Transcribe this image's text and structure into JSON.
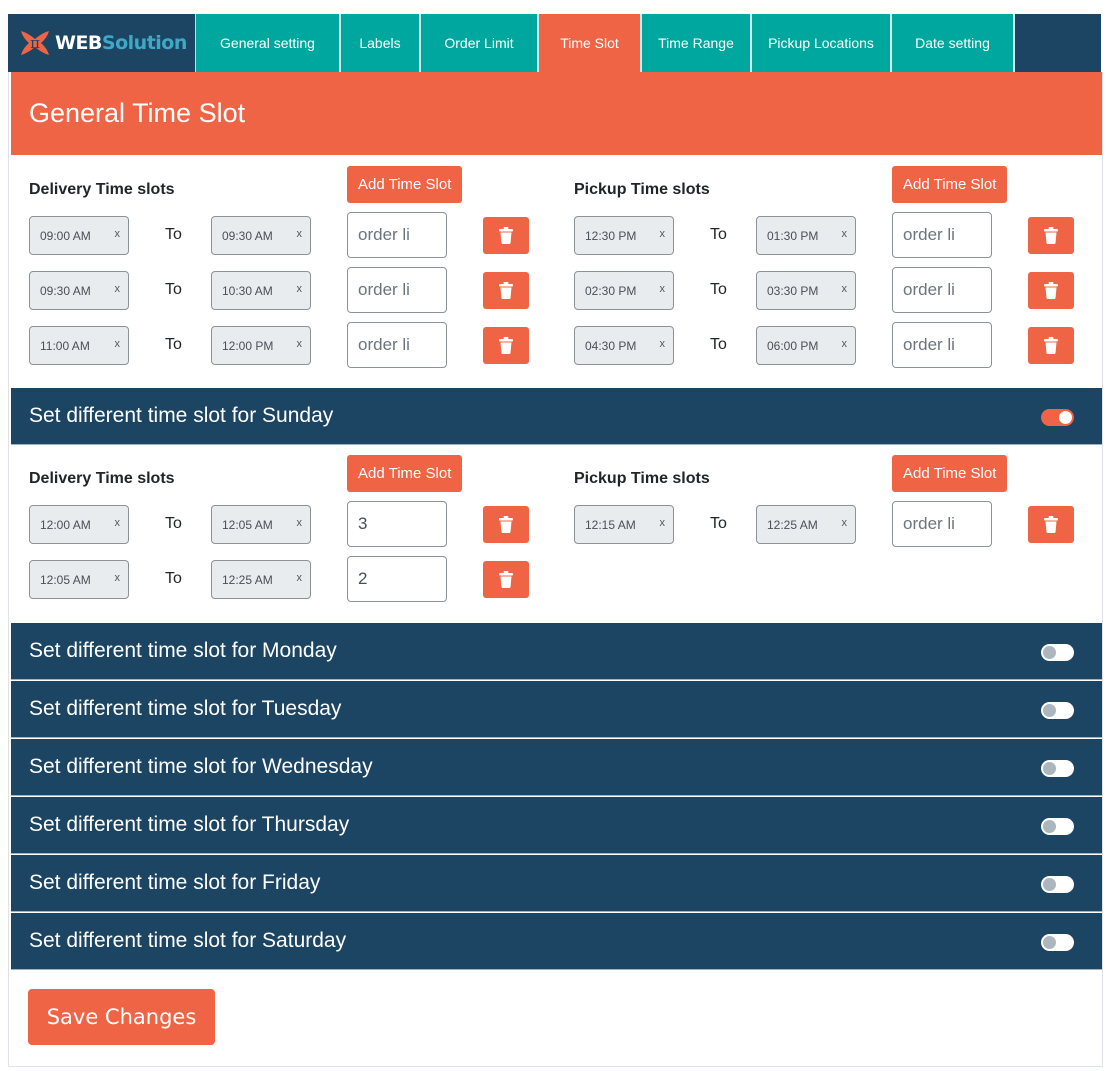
{
  "nav": {
    "logo": {
      "mark": "π",
      "web": "WEB",
      "solution": "Solution"
    },
    "tabs": [
      {
        "label": "General setting",
        "active": false
      },
      {
        "label": "Labels",
        "active": false
      },
      {
        "label": "Order Limit",
        "active": false
      },
      {
        "label": "Time Slot",
        "active": true
      },
      {
        "label": "Time Range",
        "active": false
      },
      {
        "label": "Pickup Locations",
        "active": false
      },
      {
        "label": "Date setting",
        "active": false
      }
    ]
  },
  "section_title": "General Time Slot",
  "general": {
    "delivery": {
      "title": "Delivery Time slots",
      "add_label": "Add Time Slot",
      "rows": [
        {
          "from": "09:00 AM",
          "to": "09:30 AM",
          "limit": "",
          "placeholder": "order li"
        },
        {
          "from": "09:30 AM",
          "to": "10:30 AM",
          "limit": "",
          "placeholder": "order li"
        },
        {
          "from": "11:00 AM",
          "to": "12:00 PM",
          "limit": "",
          "placeholder": "order li"
        }
      ]
    },
    "pickup": {
      "title": "Pickup Time slots",
      "add_label": "Add Time Slot",
      "rows": [
        {
          "from": "12:30 PM",
          "to": "01:30 PM",
          "limit": "",
          "placeholder": "order li"
        },
        {
          "from": "02:30 PM",
          "to": "03:30 PM",
          "limit": "",
          "placeholder": "order li"
        },
        {
          "from": "04:30 PM",
          "to": "06:00 PM",
          "limit": "",
          "placeholder": "order li"
        }
      ]
    }
  },
  "to_label": "To",
  "clear_label": "x",
  "days": [
    {
      "label": "Set different time slot for Sunday",
      "enabled": true
    },
    {
      "label": "Set different time slot for Monday",
      "enabled": false
    },
    {
      "label": "Set different time slot for Tuesday",
      "enabled": false
    },
    {
      "label": "Set different time slot for Wednesday",
      "enabled": false
    },
    {
      "label": "Set different time slot for Thursday",
      "enabled": false
    },
    {
      "label": "Set different time slot for Friday",
      "enabled": false
    },
    {
      "label": "Set different time slot for Saturday",
      "enabled": false
    }
  ],
  "sunday": {
    "delivery": {
      "title": "Delivery Time slots",
      "add_label": "Add Time Slot",
      "rows": [
        {
          "from": "12:00 AM",
          "to": "12:05 AM",
          "limit": "3",
          "placeholder": "order li"
        },
        {
          "from": "12:05 AM",
          "to": "12:25 AM",
          "limit": "2",
          "placeholder": "order li"
        }
      ]
    },
    "pickup": {
      "title": "Pickup Time slots",
      "add_label": "Add Time Slot",
      "rows": [
        {
          "from": "12:15 AM",
          "to": "12:25 AM",
          "limit": "",
          "placeholder": "order li"
        }
      ]
    }
  },
  "save_label": "Save Changes",
  "colors": {
    "accent": "#ef6445",
    "teal": "#00a79e",
    "navy": "#1c4563"
  }
}
